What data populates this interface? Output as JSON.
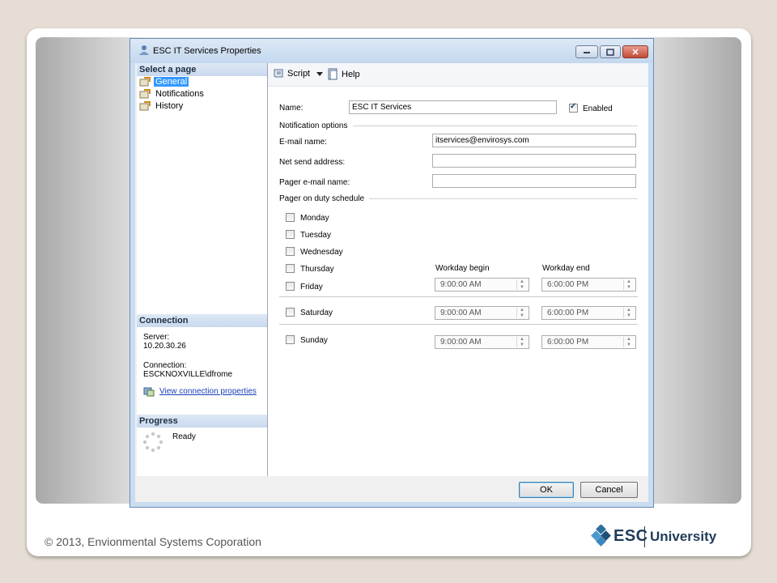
{
  "footer": {
    "copyright": "© 2013, Envionmental Systems Coporation"
  },
  "logo": {
    "esc": "ESC",
    "university": "University"
  },
  "dialog": {
    "title": "ESC IT Services Properties",
    "left": {
      "select_header": "Select a page",
      "pages": [
        "General",
        "Notifications",
        "History"
      ],
      "connection_header": "Connection",
      "server_label": "Server:",
      "server_value": "10.20.30.26",
      "connection_label": "Connection:",
      "connection_value": "ESCKNOXVILLE\\dfrome",
      "view_link": "View connection properties",
      "progress_header": "Progress",
      "progress_status": "Ready"
    },
    "toolbar": {
      "script": "Script",
      "help": "Help"
    },
    "form": {
      "name_label": "Name:",
      "name_value": "ESC IT Services",
      "enabled_label": "Enabled",
      "enabled_checked": true,
      "notification_group": "Notification options",
      "email_label": "E-mail name:",
      "email_value": "itservices@envirosys.com",
      "netsend_label": "Net send address:",
      "netsend_value": "",
      "pager_label": "Pager e-mail name:",
      "pager_value": "",
      "schedule_group": "Pager on duty schedule",
      "days": [
        "Monday",
        "Tuesday",
        "Wednesday",
        "Thursday",
        "Friday",
        "Saturday",
        "Sunday"
      ],
      "workday_begin_label": "Workday begin",
      "workday_end_label": "Workday end",
      "weekday_begin": "9:00:00 AM",
      "weekday_end": "6:00:00 PM",
      "saturday_begin": "9:00:00 AM",
      "saturday_end": "6:00:00 PM",
      "sunday_begin": "9:00:00 AM",
      "sunday_end": "6:00:00 PM"
    },
    "buttons": {
      "ok": "OK",
      "cancel": "Cancel"
    }
  },
  "colors": {
    "selection": "#3399ff",
    "link": "#1a3fb5",
    "brand": "#1f3b57"
  }
}
